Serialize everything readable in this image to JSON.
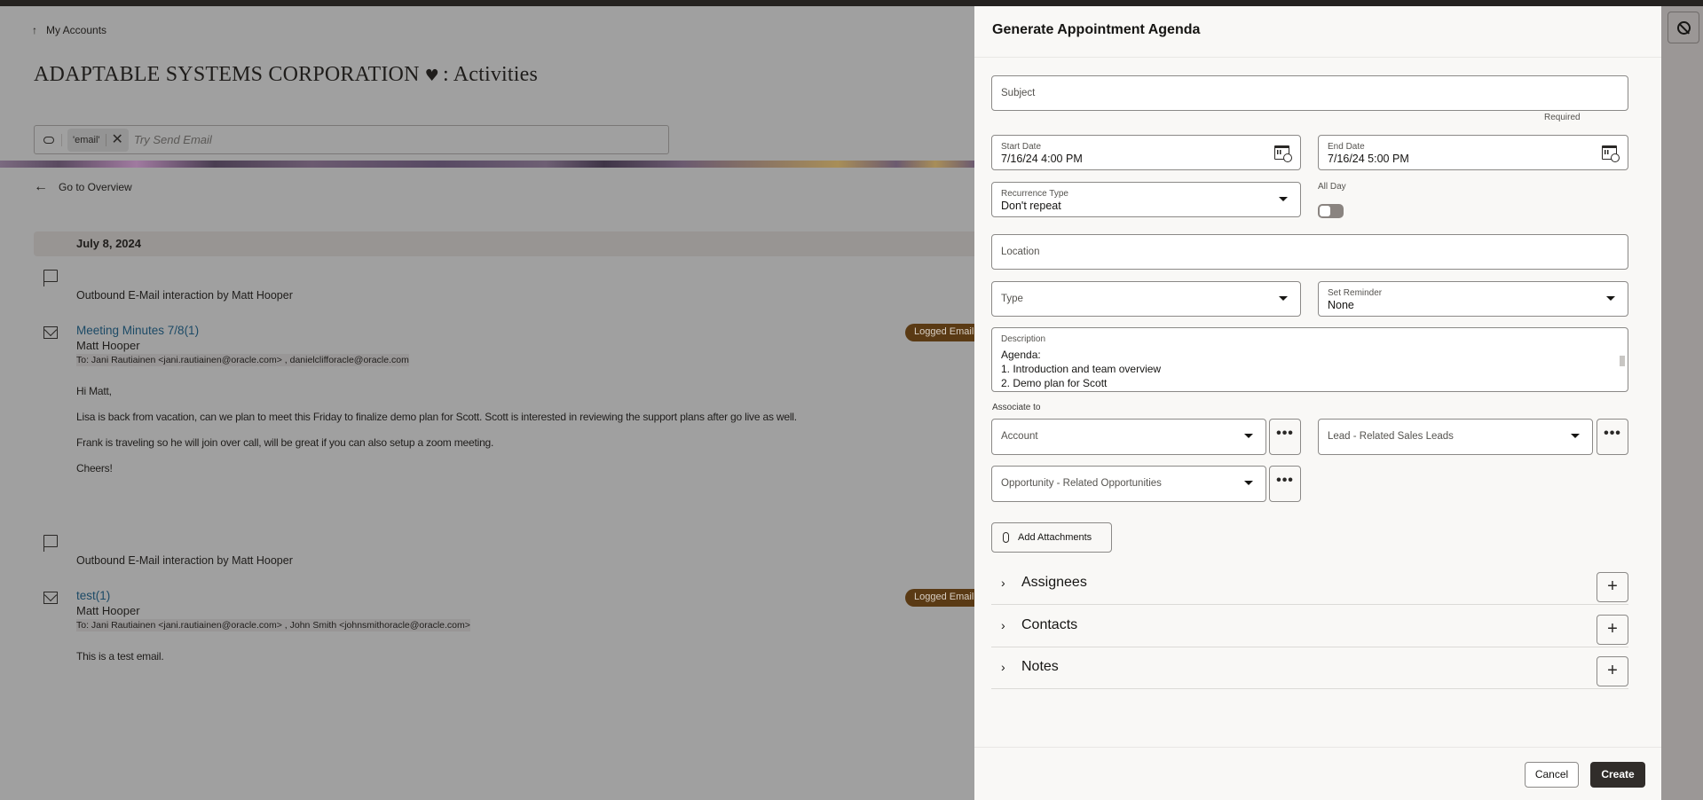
{
  "page": {
    "breadcrumb": "My Accounts",
    "title": "ADAPTABLE SYSTEMS CORPORATION",
    "title_suffix": ": Activities",
    "search": {
      "chip": "'email'",
      "placeholder": "Try Send Email"
    },
    "go_overview": "Go to Overview",
    "date_header": "July 8, 2024",
    "activities": [
      {
        "interaction": "Outbound E-Mail interaction by Matt Hooper",
        "subject": "Meeting Minutes 7/8(1)",
        "author": "Matt Hooper",
        "to": "To: Jani Rautiainen <jani.rautiainen@oracle.com> , danielclifforacle@oracle.com",
        "badge": "Logged Email",
        "body": [
          "Hi Matt,",
          "Lisa is back from vacation, can we plan to meet this Friday to finalize demo plan for Scott.  Scott is interested in reviewing the support plans after go live as well.",
          "Frank is traveling so he will join over call, will be great if you can also setup a zoom meeting.",
          "Cheers!"
        ]
      },
      {
        "interaction": "Outbound E-Mail interaction by Matt Hooper",
        "subject": "test(1)",
        "author": "Matt Hooper",
        "to": "To: Jani Rautiainen <jani.rautiainen@oracle.com> , John Smith <johnsmithoracle@oracle.com>",
        "badge": "Logged Email",
        "body": [
          "This is a test email."
        ]
      }
    ]
  },
  "drawer": {
    "title": "Generate Appointment Agenda",
    "subject": {
      "placeholder": "Subject",
      "value": "",
      "hint": "Required"
    },
    "start_date": {
      "label": "Start Date",
      "value": "7/16/24 4:00 PM"
    },
    "end_date": {
      "label": "End Date",
      "value": "7/16/24 5:00 PM"
    },
    "recurrence": {
      "label": "Recurrence Type",
      "value": "Don't repeat"
    },
    "all_day": {
      "label": "All Day",
      "on": false
    },
    "location": {
      "placeholder": "Location"
    },
    "type": {
      "placeholder": "Type"
    },
    "reminder": {
      "label": "Set Reminder",
      "value": "None"
    },
    "description": {
      "label": "Description",
      "lines": [
        "Agenda:",
        "1. Introduction and team overview",
        "2. Demo plan for Scott"
      ]
    },
    "associate_label": "Associate to",
    "associations": {
      "account": "Account",
      "lead": "Lead - Related Sales Leads",
      "opportunity": "Opportunity - Related Opportunities",
      "more": "•••"
    },
    "attachments_label": "Add Attachments",
    "sections": [
      {
        "title": "Assignees"
      },
      {
        "title": "Contacts"
      },
      {
        "title": "Notes"
      }
    ],
    "add_symbol": "+",
    "cancel_label": "Cancel",
    "create_label": "Create"
  },
  "colors": {
    "overlay": "#a0a0a0",
    "drawer_bg": "#f9f8f6",
    "primary_button": "#312d2a",
    "badge": "#5a3a14",
    "link": "#1c4a66"
  }
}
